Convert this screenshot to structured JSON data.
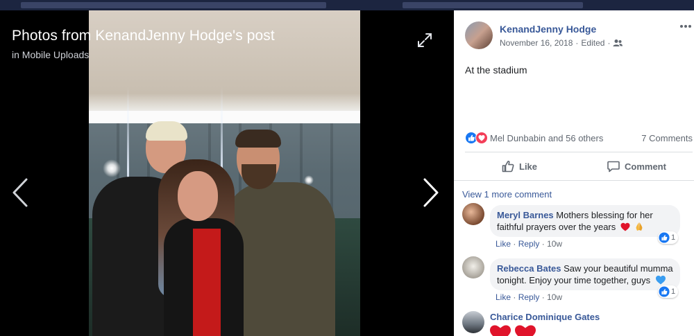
{
  "viewer": {
    "title": "Photos from KenandJenny Hodge's post",
    "in_label": "in",
    "album": "Mobile Uploads"
  },
  "post": {
    "author": "KenandJenny Hodge",
    "date": "November 16, 2018",
    "edited": "Edited",
    "separator": "·",
    "text": "At the stadium",
    "reactions_text": "Mel Dunbabin and 56 others",
    "comments_count": "7 Comments",
    "like_label": "Like",
    "comment_label": "Comment"
  },
  "comments": {
    "view_more": "View 1 more comment",
    "items": [
      {
        "author": "Meryl Barnes",
        "text": "Mothers blessing for her faithful prayers over the years",
        "like": "Like",
        "reply": "Reply",
        "time": "10w",
        "reaction_count": "1"
      },
      {
        "author": "Rebecca Bates",
        "text": "Saw your beautiful mumma tonight. Enjoy your time together, guys",
        "like": "Like",
        "reply": "Reply",
        "time": "10w",
        "reaction_count": "1"
      },
      {
        "author": "Charice Dominique Gates"
      }
    ]
  },
  "icons": {
    "expand": "expand-icon",
    "prev": "chevron-left-icon",
    "next": "chevron-right-icon",
    "more": "more-options-icon",
    "audience": "friends-icon",
    "like": "thumbs-up-icon",
    "comment": "comment-bubble-icon",
    "love": "heart-icon"
  },
  "colors": {
    "link": "#385898",
    "like_blue": "#1877f2",
    "love_red": "#f33e58",
    "panel_bg": "#ffffff",
    "viewer_bg": "#000000"
  }
}
